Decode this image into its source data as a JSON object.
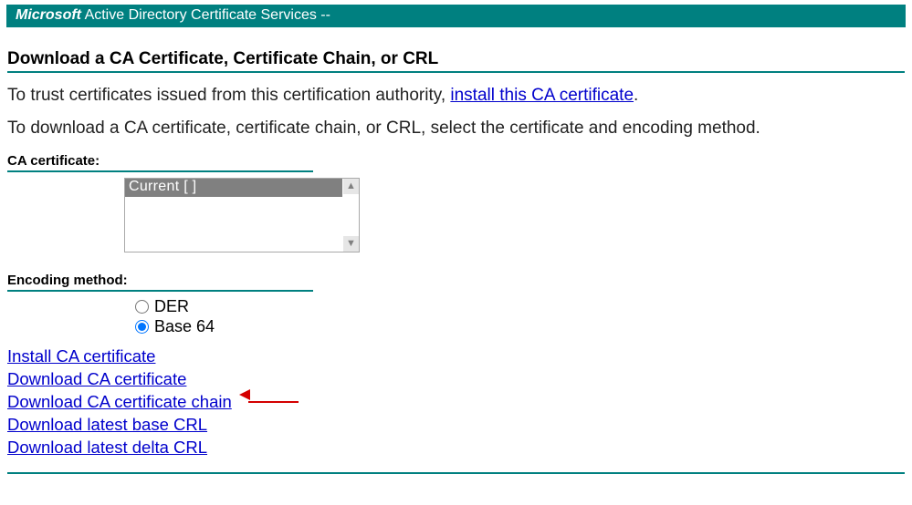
{
  "header": {
    "brand": "Microsoft",
    "product": " Active Directory Certificate Services  --"
  },
  "title": "Download a CA Certificate, Certificate Chain, or CRL",
  "intro1_pre": "To trust certificates issued from this certification authority, ",
  "intro1_link": "install this CA certificate",
  "intro1_post": ".",
  "intro2": "To download a CA certificate, certificate chain, or CRL, select the certificate and encoding method.",
  "section_cert_label": "CA certificate:",
  "listbox": {
    "selected": "Current [                                          ]",
    "scroll_up_glyph": "▲",
    "scroll_down_glyph": "▼"
  },
  "section_enc_label": "Encoding method:",
  "encoding": {
    "der": "DER",
    "base64": "Base 64"
  },
  "links": {
    "install": "Install CA certificate",
    "dl_cert": "Download CA certificate",
    "dl_chain": "Download CA certificate chain",
    "dl_base_crl": "Download latest base CRL",
    "dl_delta_crl": "Download latest delta CRL"
  }
}
